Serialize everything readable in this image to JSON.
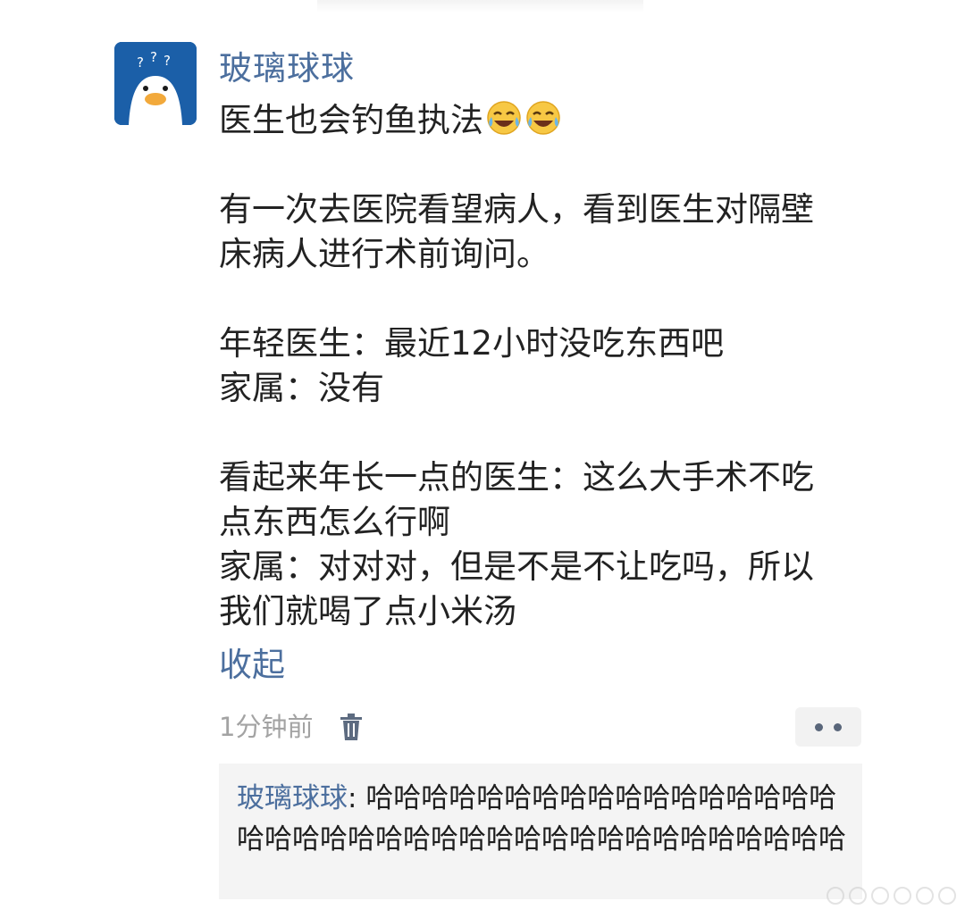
{
  "post": {
    "username": "玻璃球球",
    "headline": "医生也会钓鱼执法",
    "headline_emojis": [
      "face-with-tears-of-joy-icon",
      "face-with-tears-of-joy-icon"
    ],
    "para1_line1": "有一次去医院看望病人，看到医生对隔壁",
    "para1_line2": "床病人进行术前询问。",
    "para2_line1": "年轻医生：最近12小时没吃东西吧",
    "para2_line2": "家属：没有",
    "para3_line1": "看起来年长一点的医生：这么大手术不吃",
    "para3_line2": "点东西怎么行啊",
    "para3_line3": "家属：对对对，但是不是不让吃吗，所以",
    "para3_line4": "我们就喝了点小米汤",
    "collapse_label": "收起",
    "timestamp": "1分钟前"
  },
  "comment": {
    "author": "玻璃球球",
    "separator": ": ",
    "text": "哈哈哈哈哈哈哈哈哈哈哈哈哈哈哈哈哈哈哈哈哈哈哈哈哈哈哈哈哈哈哈哈哈哈哈哈哈哈哈"
  },
  "colors": {
    "link_blue": "#4c6f9e",
    "avatar_blue": "#1b5fa8",
    "body_text": "#222222",
    "muted_text": "#a3a3a3",
    "comment_bg": "#f4f4f4"
  }
}
